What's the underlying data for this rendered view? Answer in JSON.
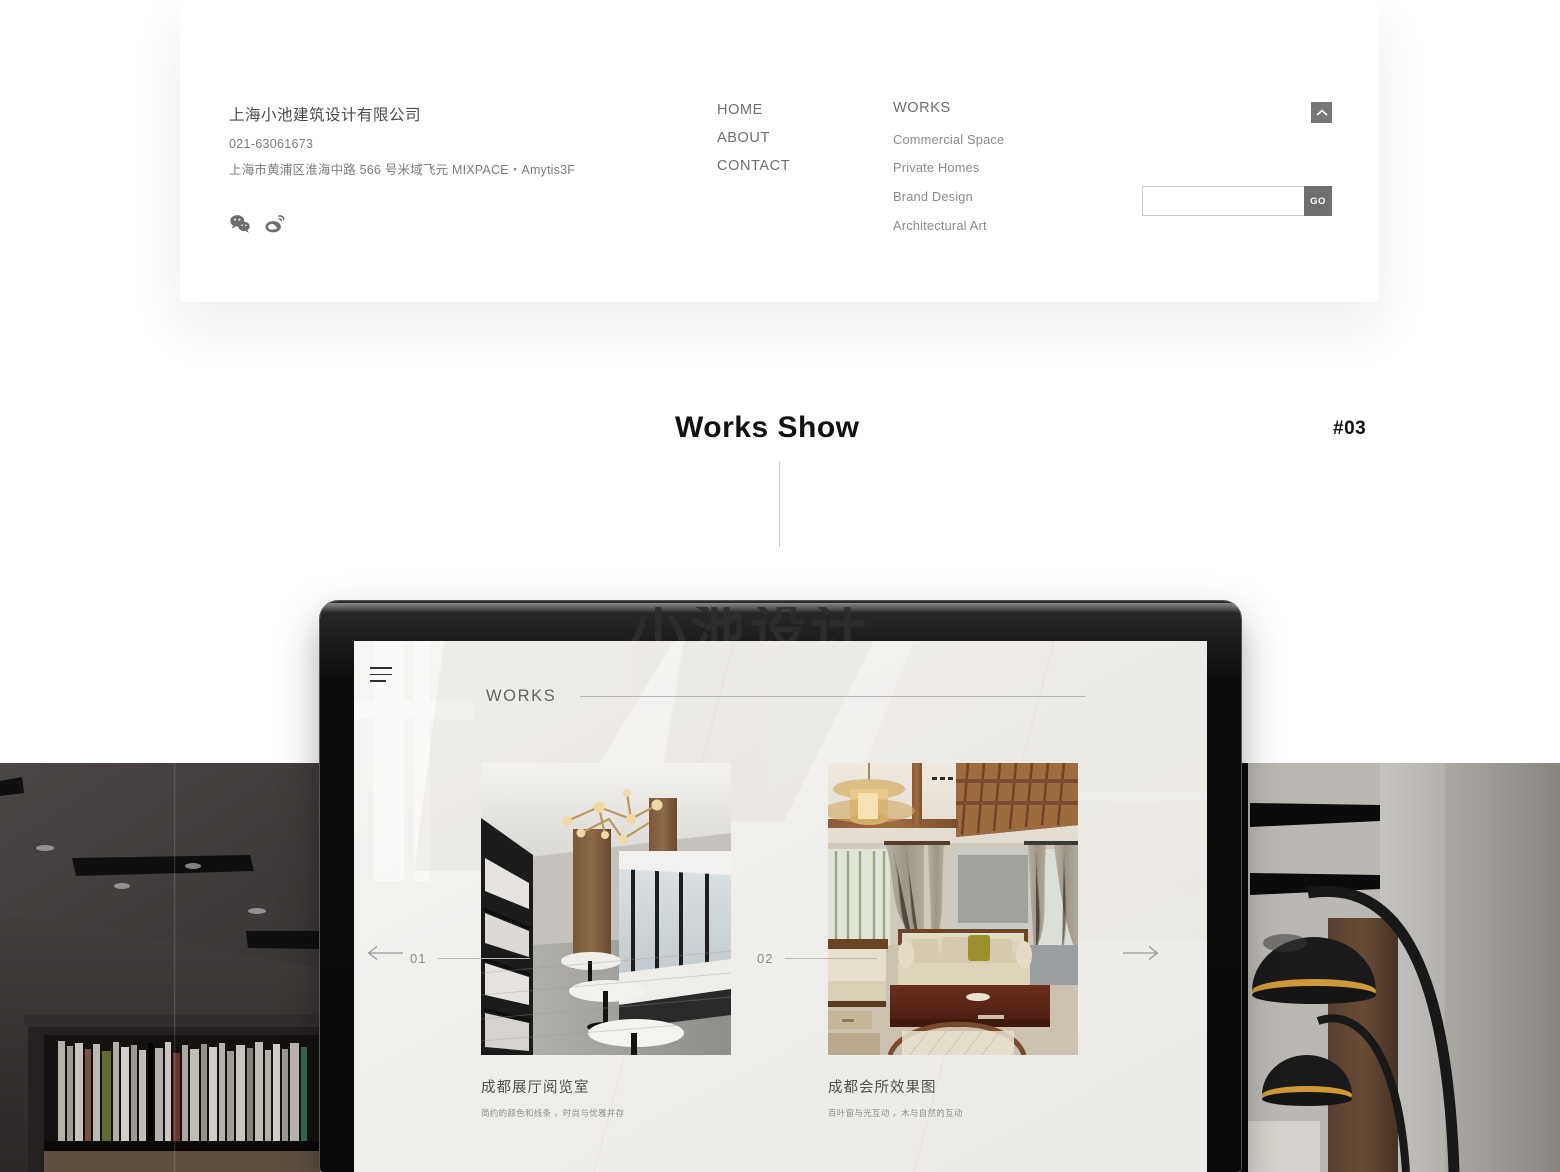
{
  "footer": {
    "company": {
      "name": "上海小池建筑设计有限公司",
      "phone": "021-63061673",
      "address": "上海市黄浦区淮海中路 566 号米域飞元 MIXPACE・Amytis3F"
    },
    "social": [
      {
        "name": "wechat-icon",
        "label": "WeChat"
      },
      {
        "name": "weibo-icon",
        "label": "Weibo"
      }
    ],
    "nav_main": [
      {
        "label": "HOME"
      },
      {
        "label": "ABOUT"
      },
      {
        "label": "CONTACT"
      }
    ],
    "nav_works": {
      "title": "WORKS",
      "items": [
        {
          "label": "Commercial Space"
        },
        {
          "label": "Private Homes"
        },
        {
          "label": "Brand Design"
        },
        {
          "label": "Architectural Art"
        }
      ]
    },
    "search": {
      "value": "",
      "placeholder": "",
      "go_label": "GO"
    },
    "back_to_top": {
      "icon": "chevron-up-icon"
    }
  },
  "section": {
    "title": "Works Show",
    "number": "#03"
  },
  "device": {
    "ghost_text": "小池设计",
    "screen": {
      "works_label": "WORKS",
      "cards": [
        {
          "index": "01",
          "title": "成都展厅阅览室",
          "subtitle": "简约的颜色和线条 ，时尚与优雅并存"
        },
        {
          "index": "02",
          "title": "成都会所效果图",
          "subtitle": "百叶窗与光互动 ，木与自然的互动"
        }
      ],
      "prev_label": "←",
      "next_label": "→"
    }
  },
  "colors": {
    "card_bg": "#ffffff",
    "page_bg": "#ffffff",
    "text_dark": "#111111",
    "text_muted": "#6d6d6d",
    "text_light": "#8a8a8a",
    "accent_gray": "#6f6f6f",
    "rule": "#c6c6c6",
    "device_frame": "#0a0a0a"
  }
}
